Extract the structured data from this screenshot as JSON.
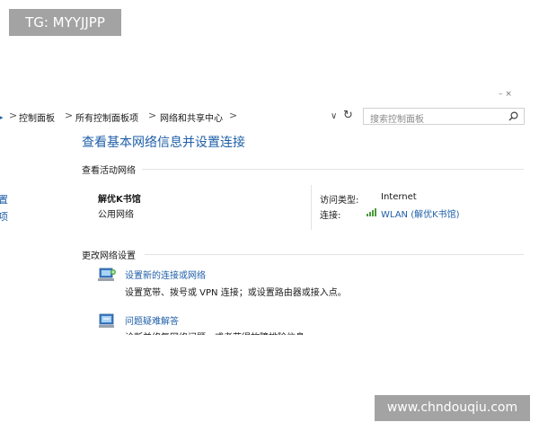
{
  "badge": {
    "text": "TG: MYYJJPP"
  },
  "window_buttons": "–    ×",
  "address_bar": {
    "breadcrumbs": [
      "控制面板",
      "所有控制面板项",
      "网络和共享中心"
    ],
    "separator": ">",
    "nav_arrow": "▸",
    "dropdown": "∨",
    "refresh": "↻",
    "search_placeholder": "搜索控制面板"
  },
  "left_fragments": [
    "置",
    "项"
  ],
  "page": {
    "title": "查看基本网络信息并设置连接",
    "active_networks_header": "查看活动网络",
    "network": {
      "name": "解优K书馆",
      "type": "公用网络",
      "access_label": "访问类型:",
      "access_value": "Internet",
      "connection_label": "连接:",
      "connection_value": "WLAN (解优K书馆)"
    },
    "change_settings_header": "更改网络设置",
    "tasks": [
      {
        "link": "设置新的连接或网络",
        "desc": "设置宽带、拨号或 VPN 连接；或设置路由器或接入点。",
        "icon": "network-setup-icon"
      },
      {
        "link": "问题疑难解答",
        "desc": "诊断并修复网络问题，或者获得故障排除信息。",
        "icon": "troubleshoot-icon"
      }
    ]
  },
  "watermark": {
    "text": "www.chndouqiu.com"
  },
  "colors": {
    "link": "#1f5fa8",
    "badge_bg": "#a3a3a3",
    "signal": "#4a9a3c"
  }
}
